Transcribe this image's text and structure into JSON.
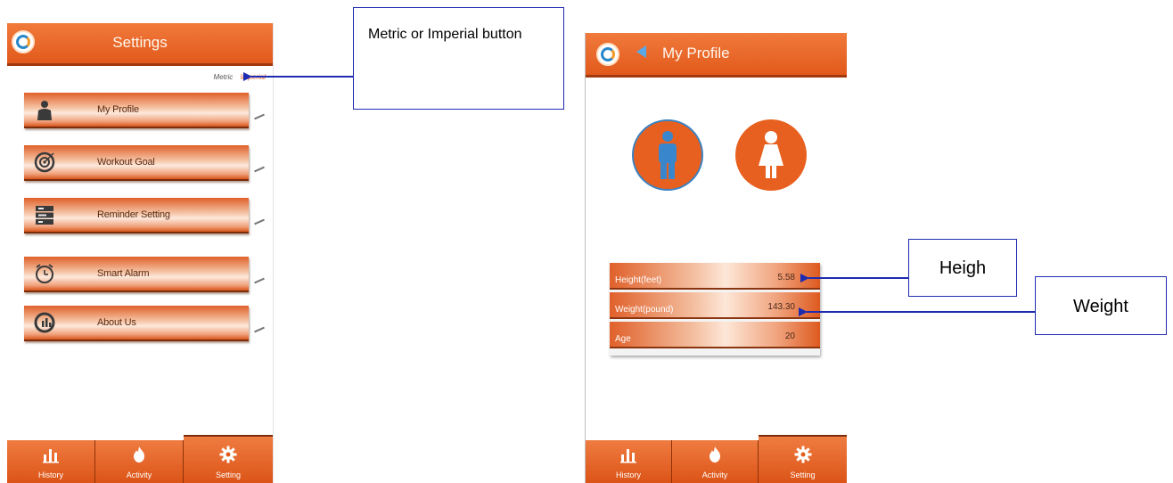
{
  "settings_screen": {
    "title": "Settings",
    "unit_toggle": {
      "metric": "Metric",
      "imperial": "Imperial"
    },
    "menu": [
      {
        "label": "My Profile",
        "icon": "person-icon"
      },
      {
        "label": "Workout Goal",
        "icon": "target-icon"
      },
      {
        "label": "Reminder Setting",
        "icon": "reminder-icon"
      },
      {
        "label": "Smart Alarm",
        "icon": "alarm-clock-icon"
      },
      {
        "label": "About Us",
        "icon": "info-icon"
      }
    ],
    "tabs": [
      {
        "label": "History",
        "icon": "bar-chart-icon"
      },
      {
        "label": "Activity",
        "icon": "flame-icon"
      },
      {
        "label": "Setting",
        "icon": "gear-icon",
        "active": true
      }
    ]
  },
  "profile_screen": {
    "title": "My Profile",
    "gender_selected": "male",
    "stats": [
      {
        "label": "Height(feet)",
        "value": "5.58"
      },
      {
        "label": "Weight(pound)",
        "value": "143.30"
      },
      {
        "label": "Age",
        "value": "20"
      }
    ],
    "tabs": [
      {
        "label": "History",
        "icon": "bar-chart-icon"
      },
      {
        "label": "Activity",
        "icon": "flame-icon"
      },
      {
        "label": "Setting",
        "icon": "gear-icon",
        "active": true
      }
    ]
  },
  "annotations": {
    "unit_button": "Metric or Imperial button",
    "height": "Heigh",
    "weight": "Weight"
  },
  "colors": {
    "accent_orange": "#e25a1b",
    "annotation_blue": "#1d2bb0",
    "male_blue": "#3a82c2"
  }
}
